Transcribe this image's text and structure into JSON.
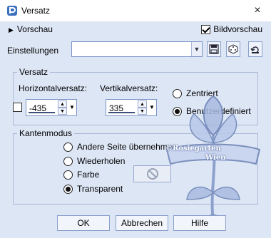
{
  "window": {
    "title": "Versatz",
    "close_glyph": "×"
  },
  "preview": {
    "label": "Vorschau",
    "bildvorschau_label": "Bildvorschau",
    "bildvorschau_checked": true
  },
  "settings": {
    "label": "Einstellungen",
    "value": ""
  },
  "offset": {
    "group_label": "Versatz",
    "horizontal_label": "Horizontalversatz:",
    "horizontal_value": "-435",
    "vertical_label": "Vertikalversatz:",
    "vertical_value": "335",
    "centered_label": "Zentriert",
    "custom_label": "Benutzerdefiniert",
    "selected": "custom"
  },
  "edge_mode": {
    "group_label": "Kantenmodus",
    "options": [
      "Andere Seite übernehmen",
      "Wiederholen",
      "Farbe",
      "Transparent"
    ],
    "selected": "Transparent"
  },
  "watermark": {
    "line1": "©Rosiegarten",
    "line2": "Wien"
  },
  "buttons": {
    "ok": "OK",
    "cancel": "Abbrechen",
    "help": "Hilfe"
  },
  "icons": [
    "app-icon",
    "save-icon",
    "dice-icon",
    "reset-icon",
    "no-color-icon"
  ]
}
